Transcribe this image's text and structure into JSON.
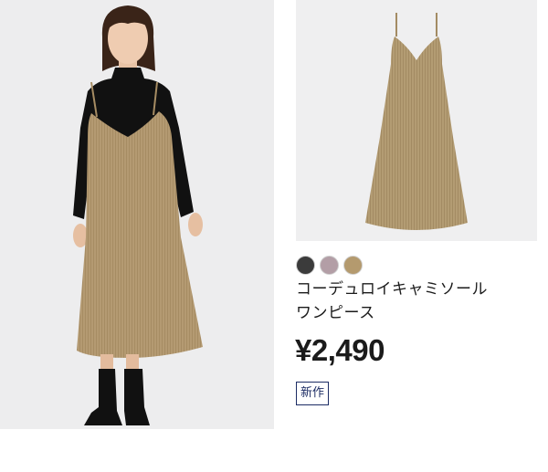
{
  "product": {
    "name_line1": "コーデュロイキャミソール",
    "name_line2": "ワンピース",
    "price": "¥2,490",
    "badge": "新作",
    "colors": [
      {
        "name": "black-swatch",
        "hex": "#3b3b3b"
      },
      {
        "name": "pink-swatch",
        "hex": "#b39ea6"
      },
      {
        "name": "beige-swatch",
        "hex": "#b49a6e"
      }
    ]
  },
  "colors": {
    "dress": "#b49a72",
    "background": "#eeeeef",
    "badge_navy": "#1c2c64"
  }
}
